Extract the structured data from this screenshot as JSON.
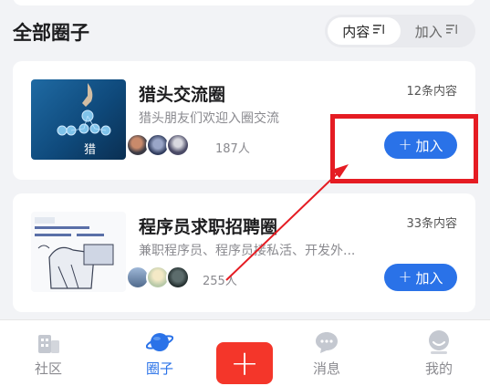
{
  "section": {
    "title": "全部圈子",
    "sort_options": [
      {
        "label": "内容",
        "active": true
      },
      {
        "label": "加入",
        "active": false
      }
    ]
  },
  "circles": [
    {
      "title": "猎头交流圈",
      "description": "猎头朋友们欢迎入圈交流",
      "content_count": "12条内容",
      "member_count": "187人",
      "join_label": "加入",
      "thumb_text": "猎"
    },
    {
      "title": "程序员求职招聘圈",
      "description": "兼职程序员、程序员接私活、开发外...",
      "content_count": "33条内容",
      "member_count": "255人",
      "join_label": "加入"
    }
  ],
  "tabbar": {
    "items": [
      {
        "label": "社区",
        "icon": "building-icon",
        "active": false
      },
      {
        "label": "圈子",
        "icon": "planet-icon",
        "active": true
      },
      {
        "label": "消息",
        "icon": "chat-bubble-icon",
        "active": false
      },
      {
        "label": "我的",
        "icon": "user-icon",
        "active": false
      }
    ],
    "add_label": "+"
  },
  "colors": {
    "accent": "#2a72e8",
    "add_button": "#f4362a",
    "annotation": "#e51c23"
  }
}
